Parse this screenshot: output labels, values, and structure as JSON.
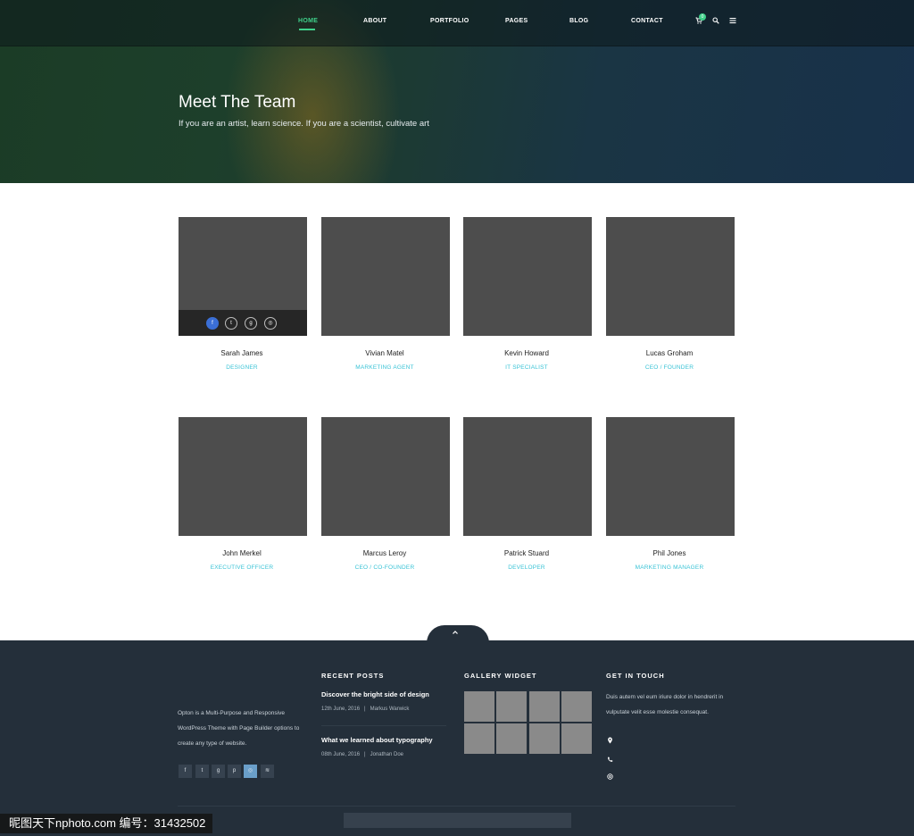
{
  "nav": {
    "items": [
      {
        "label": "HOME",
        "active": true
      },
      {
        "label": "ABOUT",
        "active": false
      },
      {
        "label": "PORTFOLIO",
        "active": false
      },
      {
        "label": "PAGES",
        "active": false
      },
      {
        "label": "BLOG",
        "active": false
      },
      {
        "label": "CONTACT",
        "active": false
      }
    ],
    "cart_count": "0",
    "icons": [
      "cart-icon",
      "search-icon",
      "menu-icon"
    ],
    "accent_color": "#3fd08a"
  },
  "hero": {
    "title": "Meet The Team",
    "subtitle": "If you are an artist, learn science. If you are a scientist, cultivate art"
  },
  "team": {
    "members": [
      {
        "name": "Sarah James",
        "role": "DESIGNER"
      },
      {
        "name": "Vivian Matel",
        "role": "MARKETING AGENT"
      },
      {
        "name": "Kevin Howard",
        "role": "IT SPECIALIST"
      },
      {
        "name": "Lucas Groham",
        "role": "CEO / FOUNDER"
      },
      {
        "name": "John Merkel",
        "role": "EXECUTIVE OFFICER"
      },
      {
        "name": "Marcus Leroy",
        "role": "CEO / CO-FOUNDER"
      },
      {
        "name": "Patrick Stuard",
        "role": "DEVELOPER"
      },
      {
        "name": "Phil Jones",
        "role": "MARKETING MANAGER"
      }
    ],
    "hover_social": {
      "icons": [
        {
          "name": "facebook-icon",
          "glyph": "f"
        },
        {
          "name": "twitter-icon",
          "glyph": "t"
        },
        {
          "name": "google-plus-icon",
          "glyph": "g"
        },
        {
          "name": "instagram-icon",
          "glyph": "◎"
        }
      ]
    },
    "role_color": "#39c3d6"
  },
  "footer": {
    "about_text": "Opton is a Multi-Purpose and Responsive WordPress Theme with Page Builder options to create any type of website.",
    "social": [
      {
        "name": "facebook-icon",
        "glyph": "f"
      },
      {
        "name": "twitter-icon",
        "glyph": "t"
      },
      {
        "name": "google-plus-icon",
        "glyph": "g"
      },
      {
        "name": "pinterest-icon",
        "glyph": "p"
      },
      {
        "name": "instagram-icon",
        "glyph": "◎"
      },
      {
        "name": "rss-icon",
        "glyph": "≋"
      }
    ],
    "recent_posts": {
      "heading": "RECENT POSTS",
      "posts": [
        {
          "title": "Discover the bright side of design",
          "date": "12th June, 2016",
          "author": "Markus Warwick"
        },
        {
          "title": "What we learned about typography",
          "date": "08th June, 2016",
          "author": "Jonathan Doe"
        }
      ]
    },
    "gallery": {
      "heading": "GALLERY WIDGET",
      "tile_count": 8
    },
    "contact": {
      "heading": "GET IN TOUCH",
      "text": "Duis autem vel eum iriure dolor in hendrerit in vulputate velit esse molestie consequat.",
      "icons": [
        "location-icon",
        "phone-icon",
        "email-icon"
      ]
    }
  },
  "watermark": "昵图天下nphoto.com  编号：31432502"
}
